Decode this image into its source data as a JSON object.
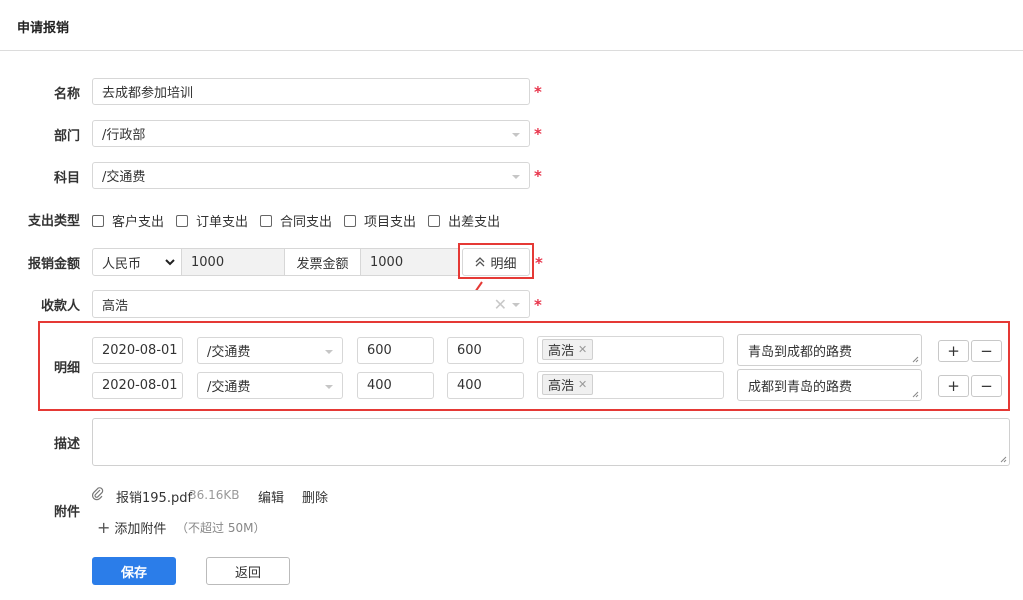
{
  "page": {
    "title": "申请报销"
  },
  "form": {
    "name": {
      "label": "名称",
      "value": "去成都参加培训"
    },
    "dept": {
      "label": "部门",
      "value": "/行政部"
    },
    "subject": {
      "label": "科目",
      "value": "/交通费"
    },
    "expense_type": {
      "label": "支出类型",
      "options": [
        "客户支出",
        "订单支出",
        "合同支出",
        "项目支出",
        "出差支出"
      ]
    },
    "amount": {
      "label": "报销金额",
      "currency": "人民币",
      "value": "1000",
      "invoice_label": "发票金额",
      "invoice_value": "1000",
      "detail_toggle": "明细"
    },
    "payee": {
      "label": "收款人",
      "value": "高浩"
    },
    "details": {
      "label": "明细",
      "rows": [
        {
          "date": "2020-08-01",
          "subject": "/交通费",
          "amount": "600",
          "invoice": "600",
          "person": "高浩",
          "note": "青岛到成都的路费"
        },
        {
          "date": "2020-08-01",
          "subject": "/交通费",
          "amount": "400",
          "invoice": "400",
          "person": "高浩",
          "note": "成都到青岛的路费"
        }
      ]
    },
    "description": {
      "label": "描述",
      "value": ""
    },
    "attachment": {
      "label": "附件",
      "file_name": "报销195.pdf",
      "file_size": "36.16KB",
      "edit": "编辑",
      "delete": "删除",
      "add": "添加附件",
      "limit": "（不超过 50M）"
    },
    "actions": {
      "save": "保存",
      "back": "返回"
    }
  },
  "colors": {
    "primary": "#2b7de9",
    "required": "#e8334a",
    "highlight": "#e53935"
  }
}
